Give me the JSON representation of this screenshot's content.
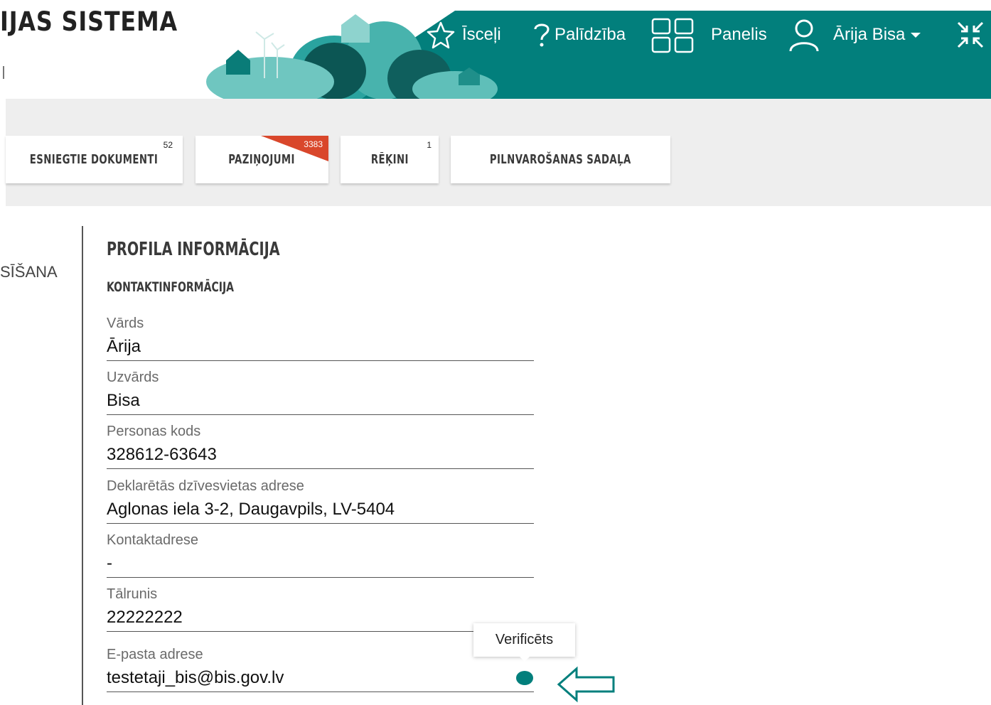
{
  "header": {
    "brand": "IJAS SISTĒMA",
    "nav": [
      {
        "label": "Īsceļi",
        "icon": "star-icon"
      },
      {
        "label": "Palīdzība",
        "icon": "help-icon"
      },
      {
        "label": "Panelis",
        "icon": "dashboard-icon"
      },
      {
        "label": "Ārija Bisa",
        "icon": "user-icon"
      }
    ],
    "collapse_icon": "collapse-icon",
    "colors": {
      "teal": "#027f7c"
    }
  },
  "tabs": [
    {
      "label": "ESNIEGTIE DOKUMENTI",
      "count": "52"
    },
    {
      "label": "PAZIŅOJUMI",
      "count": "3383",
      "badge_color": "#d9472b"
    },
    {
      "label": "RĒĶINI",
      "count": "1"
    },
    {
      "label": "PILNVAROŠANAS SADAĻA",
      "count": ""
    }
  ],
  "sidebar": {
    "item": "SĪŠANA"
  },
  "profile": {
    "title": "PROFILA INFORMĀCIJA",
    "section": "KONTAKTINFORMĀCIJA",
    "fields": [
      {
        "label": "Vārds",
        "value": "Ārija"
      },
      {
        "label": "Uzvārds",
        "value": "Bisa"
      },
      {
        "label": "Personas kods",
        "value": "328612-63643"
      },
      {
        "label": "Deklarētās dzīvesvietas adrese",
        "value": "Aglonas iela 3-2, Daugavpils, LV-5404"
      },
      {
        "label": "Kontaktadrese",
        "value": "-"
      },
      {
        "label": "Tālrunis",
        "value": "22222222"
      },
      {
        "label": "E-pasta adrese",
        "value": "testetaji_bis@bis.gov.lv"
      }
    ],
    "verified_tooltip": "Verificēts"
  }
}
